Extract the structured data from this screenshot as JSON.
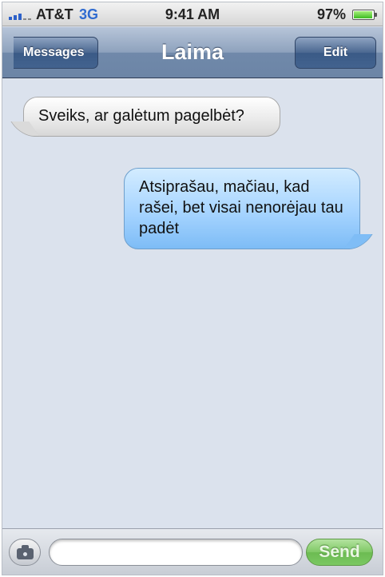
{
  "status_bar": {
    "carrier": "AT&T",
    "network": "3G",
    "time": "9:41 AM",
    "battery_percent": "97%",
    "battery_level": 0.97,
    "icons": [
      "signal-icon",
      "battery-icon"
    ]
  },
  "nav": {
    "back_label": "Messages",
    "title": "Laima",
    "edit_label": "Edit"
  },
  "messages": [
    {
      "direction": "incoming",
      "text": "Sveiks, ar galėtum pagelbėt?"
    },
    {
      "direction": "outgoing",
      "text": "Atsiprašau, mačiau, kad rašei, bet visai nenorėjau tau padėt"
    }
  ],
  "compose": {
    "camera_icon": "camera-icon",
    "input_value": "",
    "input_placeholder": "",
    "send_label": "Send"
  },
  "colors": {
    "incoming_bubble": "#e9e9e9",
    "outgoing_bubble": "#a6d4ff",
    "nav_bar": "#7089aa",
    "send_button": "#7fc865",
    "background": "#dbe2ed"
  }
}
